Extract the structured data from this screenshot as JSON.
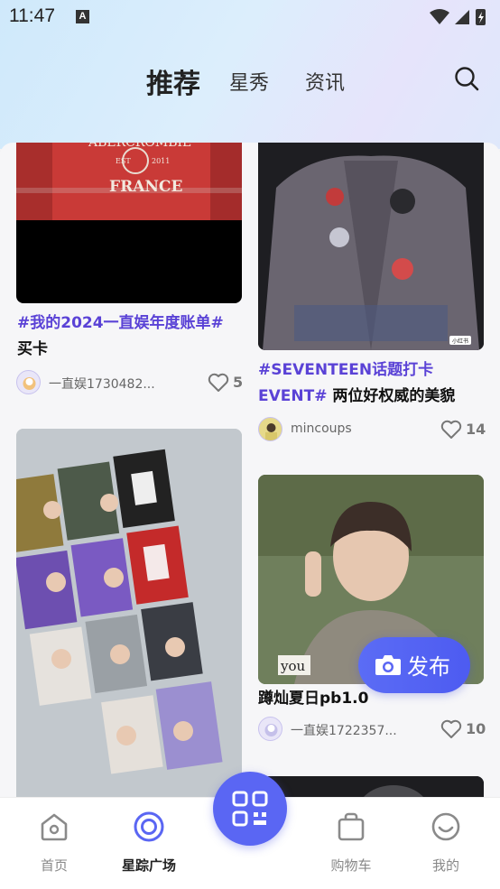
{
  "status_bar": {
    "time": "11:47",
    "app_indicator": "A"
  },
  "tabs": [
    {
      "label": "推荐",
      "active": true
    },
    {
      "label": "星秀",
      "active": false
    },
    {
      "label": "资讯",
      "active": false
    }
  ],
  "search": {
    "icon": "search-icon"
  },
  "feed": {
    "left": [
      {
        "title_tag": "#我的2024一直娱年度账单#",
        "title_text": "买卡",
        "author": "一直娱1730482...",
        "likes": "5",
        "image_text": {
          "brand": "ABERCROMBIE",
          "est": "EST",
          "year": "2011",
          "country": "FRANCE"
        }
      },
      {
        "title_tag": "",
        "title_text": "",
        "author": "",
        "likes": ""
      }
    ],
    "right": [
      {
        "title_tag": "#SEVENTEEN话题打卡EVENT#",
        "title_text": " 两位好权威的美貌",
        "author": "mincoups",
        "likes": "14",
        "image_badge": "小红书"
      },
      {
        "title_tag": "",
        "title_text": "蹲灿夏日pb1.0",
        "author": "一直娱1722357...",
        "likes": "10",
        "image_text": "you"
      }
    ]
  },
  "fab": {
    "label": "发布",
    "icon": "camera-icon"
  },
  "bottom_nav": [
    {
      "label": "首页",
      "icon": "home-icon",
      "active": false
    },
    {
      "label": "星踪广场",
      "icon": "target-icon",
      "active": true
    },
    {
      "label": "",
      "icon": "qr-scan-icon",
      "active": false
    },
    {
      "label": "购物车",
      "icon": "shopping-bag-icon",
      "active": false
    },
    {
      "label": "我的",
      "icon": "smile-icon",
      "active": false
    }
  ],
  "colors": {
    "accent": "#5a66f3",
    "tag": "#5a42d6",
    "header_top": "#cfe9fb"
  }
}
